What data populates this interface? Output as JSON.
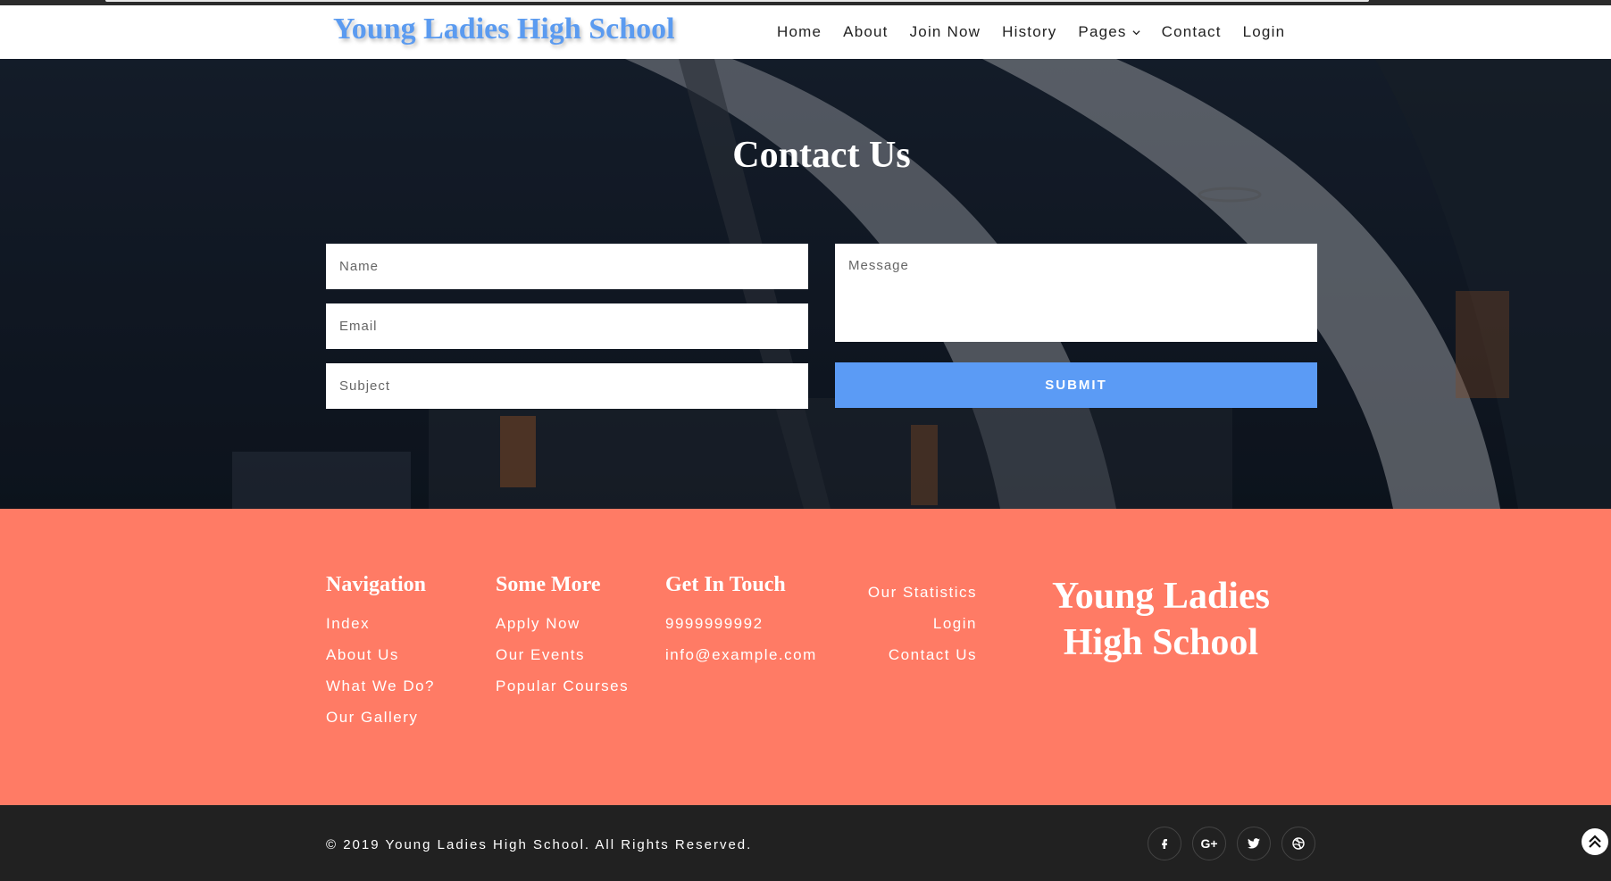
{
  "header": {
    "brand": "Young Ladies High School",
    "nav": [
      "Home",
      "About",
      "Join Now",
      "History",
      "Pages",
      "Contact",
      "Login"
    ]
  },
  "contact": {
    "title": "Contact Us",
    "name_placeholder": "Name",
    "email_placeholder": "Email",
    "subject_placeholder": "Subject",
    "message_placeholder": "Message",
    "submit_label": "SUBMIT"
  },
  "footer": {
    "navigation": {
      "heading": "Navigation",
      "links": [
        "Index",
        "About Us",
        "What We Do?",
        "Our Gallery"
      ]
    },
    "more": {
      "heading": "Some More",
      "links": [
        "Apply Now",
        "Our Events",
        "Popular Courses"
      ]
    },
    "touch": {
      "heading": "Get In Touch",
      "phone": "9999999992",
      "email": "info@example.com"
    },
    "extra_links": [
      "Our Statistics",
      "Login",
      "Contact Us"
    ],
    "brand_line1": "Young Ladies",
    "brand_line2": "High School",
    "accent_color": "#ff7b65"
  },
  "bottom": {
    "copyright": "© 2019 Young Ladies High School. All Rights Reserved.",
    "social_icons": [
      "facebook-icon",
      "google-plus-icon",
      "twitter-icon",
      "dribbble-icon"
    ],
    "google_plus_label": "G+"
  },
  "colors": {
    "brand_blue": "#5b9bf0",
    "submit_blue": "#5b9bf5",
    "bottom_bar": "#212121"
  }
}
